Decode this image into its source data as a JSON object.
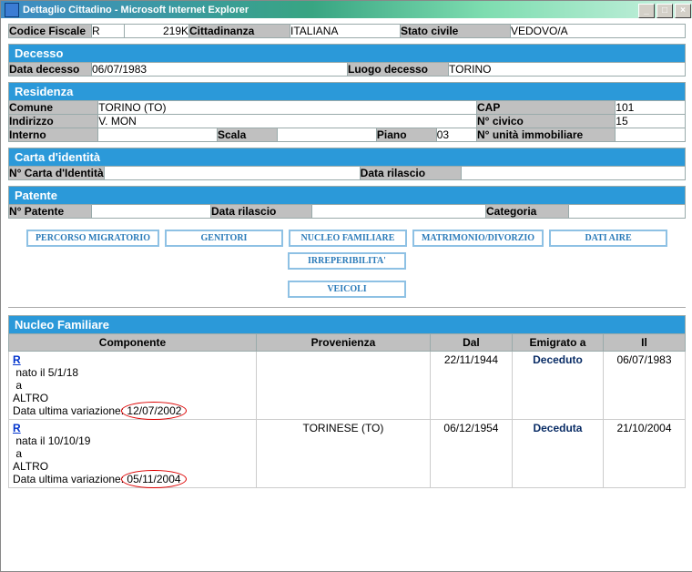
{
  "window": {
    "title": "Dettaglio Cittadino - Microsoft Internet Explorer"
  },
  "row1": {
    "codfisc_lbl": "Codice Fiscale",
    "codfisc_val1": "R",
    "codfisc_val2": "219K",
    "citt_lbl": "Cittadinanza",
    "citt_val": "ITALIANA",
    "stato_lbl": "Stato civile",
    "stato_val": "VEDOVO/A"
  },
  "decesso": {
    "head": "Decesso",
    "data_lbl": "Data decesso",
    "data_val": "06/07/1983",
    "luogo_lbl": "Luogo decesso",
    "luogo_val": "TORINO"
  },
  "residenza": {
    "head": "Residenza",
    "comune_lbl": "Comune",
    "comune_val": "TORINO (TO)",
    "cap_lbl": "CAP",
    "cap_val": "101",
    "ind_lbl": "Indirizzo",
    "ind_val": "V. MON",
    "civ_lbl": "N° civico",
    "civ_val": "15",
    "int_lbl": "Interno",
    "int_val": "",
    "scala_lbl": "Scala",
    "scala_val": "",
    "piano_lbl": "Piano",
    "piano_val": "03",
    "unita_lbl": "N° unità immobiliare",
    "unita_val": ""
  },
  "carta": {
    "head": "Carta d'identità",
    "num_lbl": "N° Carta d'Identità",
    "num_val": "",
    "ril_lbl": "Data rilascio",
    "ril_val": ""
  },
  "patente": {
    "head": "Patente",
    "num_lbl": "N° Patente",
    "num_val": "",
    "ril_lbl": "Data rilascio",
    "ril_val": "",
    "cat_lbl": "Categoria",
    "cat_val": ""
  },
  "buttons": {
    "b1": "PERCORSO MIGRATORIO",
    "b2": "GENITORI",
    "b3": "NUCLEO FAMILIARE",
    "b4": "MATRIMONIO/DIVORZIO",
    "b5": "DATI AIRE",
    "b6": "IRREPERIBILITA'",
    "b7": "VEICOLI"
  },
  "nucleo": {
    "head": "Nucleo Familiare",
    "cols": {
      "c1": "Componente",
      "c2": "Provenienza",
      "c3": "Dal",
      "c4": "Emigrato a",
      "c5": "Il"
    },
    "rows": [
      {
        "name": "R",
        "born_prefix": "nato il ",
        "born": "5/1/18",
        "a": "a",
        "luogo": "ALTRO",
        "varlbl": "Data ultima variazione: ",
        "varval": "12/07/2002",
        "prov": "",
        "dal": "22/11/1944",
        "em": "Deceduto",
        "il": "06/07/1983"
      },
      {
        "name": "R",
        "born_prefix": "nata il ",
        "born": "10/10/19",
        "a": "a",
        "luogo": "ALTRO",
        "varlbl": "Data ultima variazione: ",
        "varval": "05/11/2004",
        "prov": "TORINESE (TO)",
        "dal": "06/12/1954",
        "em": "Deceduta",
        "il": "21/10/2004"
      }
    ]
  }
}
